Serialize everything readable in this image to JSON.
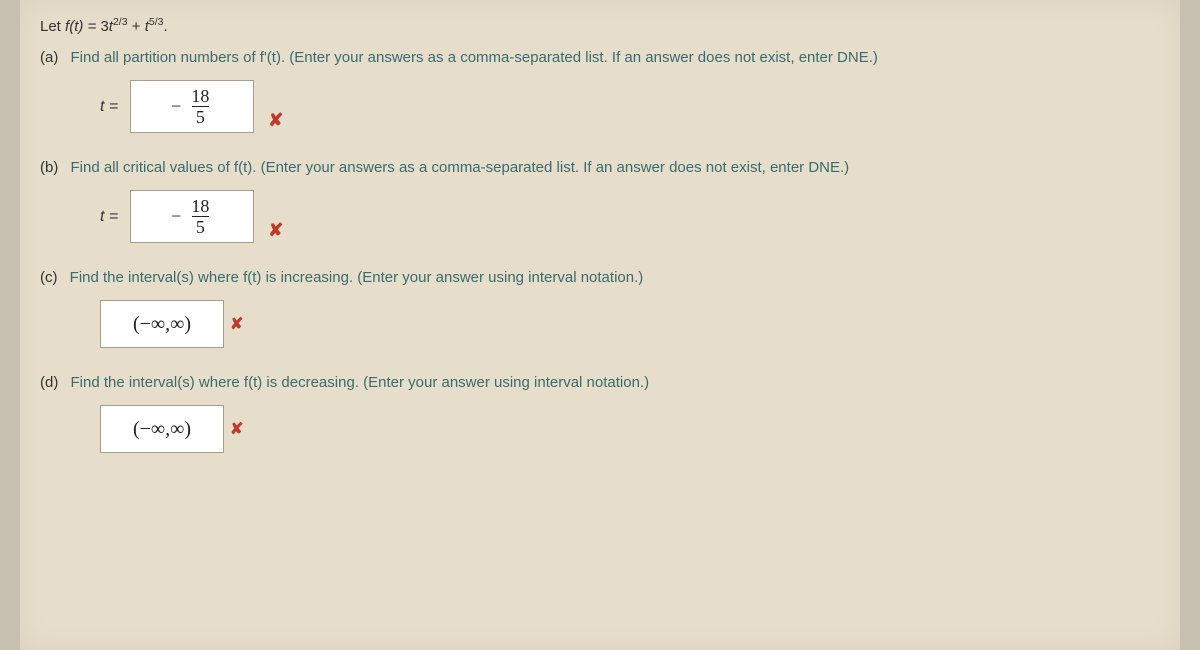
{
  "prompt": {
    "prefix": "Let ",
    "lhs": "f(t) = ",
    "term1_coef": "3",
    "term1_var": "t",
    "term1_exp": "2/3",
    "plus": " + ",
    "term2_var": "t",
    "term2_exp": "5/3",
    "period": "."
  },
  "parts": {
    "a": {
      "label": "(a)",
      "text": "Find all partition numbers of f'(t). (Enter your answers as a comma-separated list. If an answer does not exist, enter DNE.)",
      "eq_label": "t =",
      "answer_num": "18",
      "answer_den": "5",
      "neg": "−",
      "mark": "✘"
    },
    "b": {
      "label": "(b)",
      "text": "Find all critical values of f(t). (Enter your answers as a comma-separated list. If an answer does not exist, enter DNE.)",
      "eq_label": "t =",
      "answer_num": "18",
      "answer_den": "5",
      "neg": "−",
      "mark": "✘"
    },
    "c": {
      "label": "(c)",
      "text": "Find the interval(s) where f(t) is increasing. (Enter your answer using interval notation.)",
      "answer": "(−∞,∞)",
      "mark": "✘"
    },
    "d": {
      "label": "(d)",
      "text": "Find the interval(s) where f(t) is decreasing. (Enter your answer using interval notation.)",
      "answer": "(−∞,∞)",
      "mark": "✘"
    }
  }
}
